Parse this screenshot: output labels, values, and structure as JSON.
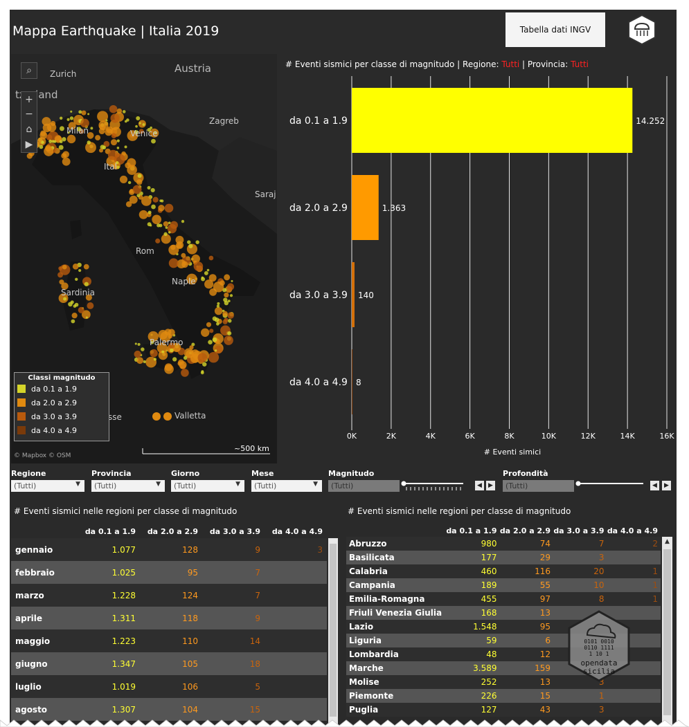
{
  "title": "Mappa Earthquake | Italia 2019",
  "table_button": "Tabella dati INGV",
  "map": {
    "countries": [
      "Austria",
      "tzerland"
    ],
    "cities": [
      "Zurich",
      "Milan",
      "Venice",
      "Zagreb",
      "Ital",
      "Rom",
      "Sardinia",
      "Naple",
      "Palermo",
      "Valletta",
      "Saraj",
      "sse"
    ],
    "legend_title": "Classi magnitudo",
    "legend": [
      {
        "label": "da 0.1 a 1.9",
        "color": "#d4d42a"
      },
      {
        "label": "da 2.0 a 2.9",
        "color": "#e08a10"
      },
      {
        "label": "da 3.0 a 3.9",
        "color": "#b85a0d"
      },
      {
        "label": "da 4.0 a 4.9",
        "color": "#7a3a0a"
      }
    ],
    "attribution": "© Mapbox © OSM",
    "scale_label": "~500 km",
    "tools": {
      "search": "⌕",
      "zoom_in": "+",
      "zoom_out": "−",
      "home": "⌂",
      "play": "▶"
    }
  },
  "chart": {
    "title_prefix": "# Eventi sismici per classe di magnitudo | Regione: ",
    "region_value": "Tutti",
    "title_mid": " | Provincia: ",
    "province_value": "Tutti",
    "accent_red": "#ff2222"
  },
  "chart_data": {
    "type": "bar",
    "orientation": "horizontal",
    "categories": [
      "da 0.1 a 1.9",
      "da 2.0 a 2.9",
      "da 3.0 a 3.9",
      "da 4.0 a 4.9"
    ],
    "values": [
      14252,
      1363,
      140,
      8
    ],
    "value_labels": [
      "14.252",
      "1.363",
      "140",
      "8"
    ],
    "colors": [
      "#ffff00",
      "#ff9a00",
      "#d4700a",
      "#8a4510"
    ],
    "xlabel": "# Eventi simici",
    "xticks": [
      "0K",
      "2K",
      "4K",
      "6K",
      "8K",
      "10K",
      "12K",
      "14K",
      "16K"
    ],
    "xlim": [
      0,
      16000
    ],
    "grid": true
  },
  "filters": [
    {
      "label": "Regione",
      "value": "(Tutti)"
    },
    {
      "label": "Provincia",
      "value": "(Tutti)"
    },
    {
      "label": "Giorno",
      "value": "(Tutti)"
    },
    {
      "label": "Mese",
      "value": "(Tutti)"
    },
    {
      "label": "Magnitudo",
      "value": "(Tutti)"
    },
    {
      "label": "Profondità",
      "value": "(Tutti)"
    }
  ],
  "months_table": {
    "title": "# Eventi sismici nelle regioni per classe di magnitudo",
    "columns": [
      "",
      "da 0.1 a 1.9",
      "da 2.0 a 2.9",
      "da 3.0 a 3.9",
      "da 4.0 a 4.9"
    ],
    "rows": [
      [
        "gennaio",
        "1.077",
        "128",
        "9",
        "3"
      ],
      [
        "febbraio",
        "1.025",
        "95",
        "7",
        ""
      ],
      [
        "marzo",
        "1.228",
        "124",
        "7",
        ""
      ],
      [
        "aprile",
        "1.311",
        "118",
        "9",
        ""
      ],
      [
        "maggio",
        "1.223",
        "110",
        "14",
        ""
      ],
      [
        "giugno",
        "1.347",
        "105",
        "18",
        ""
      ],
      [
        "luglio",
        "1.019",
        "106",
        "5",
        ""
      ],
      [
        "agosto",
        "1.307",
        "104",
        "15",
        ""
      ]
    ]
  },
  "regions_table": {
    "title": "# Eventi sismici nelle regioni per classe di magnitudo",
    "columns": [
      "",
      "da 0.1 a 1.9",
      "da 2.0 a 2.9",
      "da 3.0 a 3.9",
      "da 4.0 a 4.9"
    ],
    "rows": [
      [
        "Abruzzo",
        "980",
        "74",
        "7",
        "2"
      ],
      [
        "Basilicata",
        "177",
        "29",
        "3",
        ""
      ],
      [
        "Calabria",
        "460",
        "116",
        "20",
        "1"
      ],
      [
        "Campania",
        "189",
        "55",
        "10",
        "1"
      ],
      [
        "Emilia-Romagna",
        "455",
        "97",
        "8",
        "1"
      ],
      [
        "Friuli Venezia Giulia",
        "168",
        "13",
        "",
        ""
      ],
      [
        "Lazio",
        "1.548",
        "95",
        "",
        ""
      ],
      [
        "Liguria",
        "59",
        "6",
        "",
        ""
      ],
      [
        "Lombardia",
        "48",
        "12",
        "",
        ""
      ],
      [
        "Marche",
        "3.589",
        "159",
        "",
        ""
      ],
      [
        "Molise",
        "252",
        "13",
        "3",
        ""
      ],
      [
        "Piemonte",
        "226",
        "15",
        "1",
        ""
      ],
      [
        "Puglia",
        "127",
        "43",
        "3",
        ""
      ]
    ]
  },
  "watermark": [
    "0101 0010",
    "0110 1111",
    "1 10 1",
    "opendata",
    "sicilia"
  ]
}
